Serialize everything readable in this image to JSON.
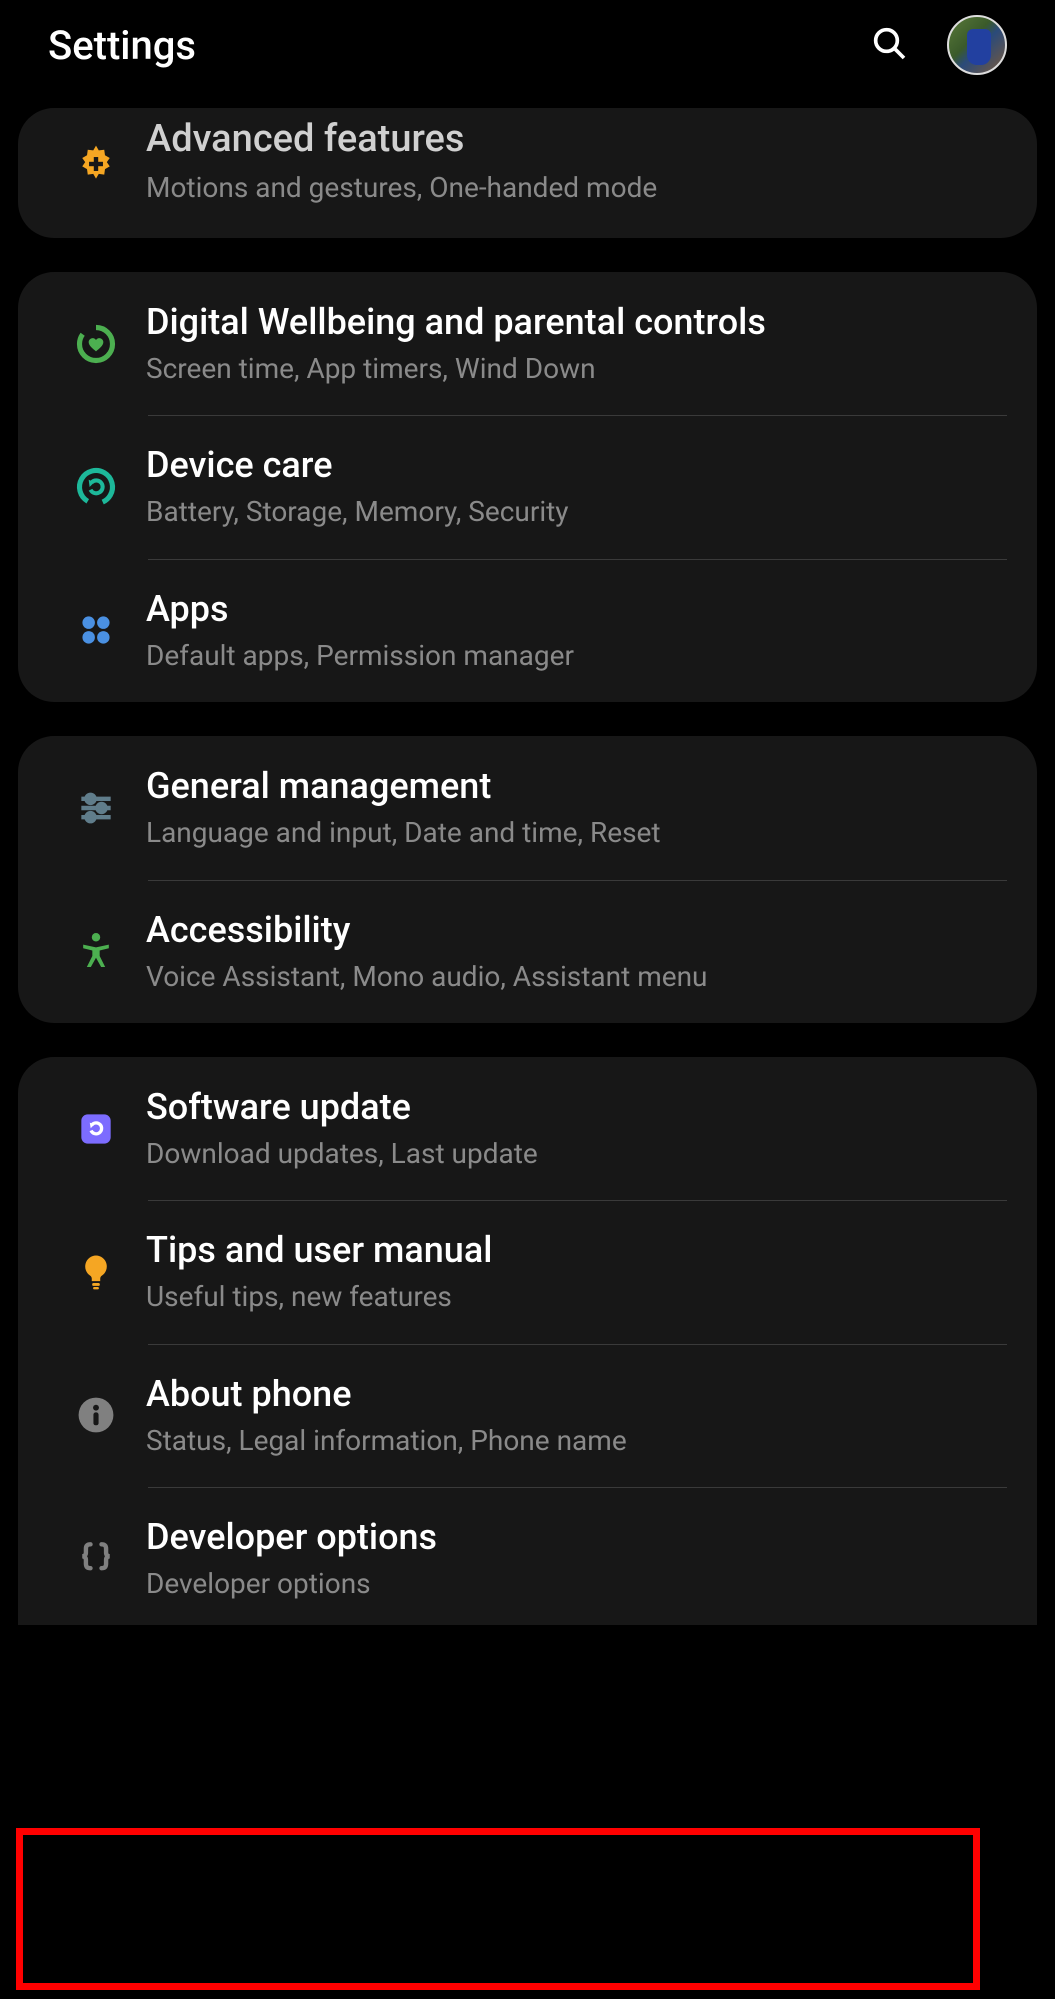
{
  "header": {
    "title": "Settings"
  },
  "groups": [
    {
      "items": [
        {
          "id": "advanced-features",
          "title": "Advanced features",
          "subtitle": "Motions and gestures, One-handed mode",
          "icon": "gear-plus-icon",
          "color": "#f5a623"
        }
      ]
    },
    {
      "items": [
        {
          "id": "digital-wellbeing",
          "title": "Digital Wellbeing and parental controls",
          "subtitle": "Screen time, App timers, Wind Down",
          "icon": "heart-ring-icon",
          "color": "#4caf50"
        },
        {
          "id": "device-care",
          "title": "Device care",
          "subtitle": "Battery, Storage, Memory, Security",
          "icon": "refresh-ring-icon",
          "color": "#1db89a"
        },
        {
          "id": "apps",
          "title": "Apps",
          "subtitle": "Default apps, Permission manager",
          "icon": "four-dots-icon",
          "color": "#4a90e2"
        }
      ]
    },
    {
      "items": [
        {
          "id": "general-management",
          "title": "General management",
          "subtitle": "Language and input, Date and time, Reset",
          "icon": "sliders-icon",
          "color": "#607d8b"
        },
        {
          "id": "accessibility",
          "title": "Accessibility",
          "subtitle": "Voice Assistant, Mono audio, Assistant menu",
          "icon": "person-icon",
          "color": "#4caf50"
        }
      ]
    },
    {
      "items": [
        {
          "id": "software-update",
          "title": "Software update",
          "subtitle": "Download updates, Last update",
          "icon": "update-badge-icon",
          "color": "#7c6cff"
        },
        {
          "id": "tips-manual",
          "title": "Tips and user manual",
          "subtitle": "Useful tips, new features",
          "icon": "bulb-icon",
          "color": "#f5a623"
        },
        {
          "id": "about-phone",
          "title": "About phone",
          "subtitle": "Status, Legal information, Phone name",
          "icon": "info-icon",
          "color": "#808080"
        },
        {
          "id": "developer-options",
          "title": "Developer options",
          "subtitle": "Developer options",
          "icon": "braces-icon",
          "color": "#808080",
          "highlighted": true
        }
      ]
    }
  ],
  "highlight": {
    "color": "#ff0000",
    "target": "developer-options"
  }
}
